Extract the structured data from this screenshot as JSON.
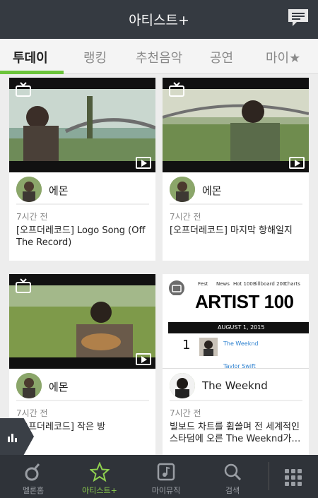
{
  "header": {
    "title": "아티스트+",
    "message_icon": "message-icon"
  },
  "tabs": [
    {
      "label": "투데이",
      "active": true
    },
    {
      "label": "랭킹",
      "active": false
    },
    {
      "label": "추천음악",
      "active": false
    },
    {
      "label": "공연",
      "active": false
    },
    {
      "label": "마이★",
      "active": false
    }
  ],
  "cards": [
    {
      "artist": "에몬",
      "time": "7시간 전",
      "caption": "[오프더레코드] Logo Song (Off The Record)"
    },
    {
      "artist": "에몬",
      "time": "7시간 전",
      "caption": "[오프더레코드] 마지막 항해일지"
    },
    {
      "artist": "에몬",
      "time": "7시간 전",
      "caption": "[오프더레코드] 작은 방"
    },
    {
      "artist": "The Weeknd",
      "time": "7시간 전",
      "caption": "빌보드 차트를 휩쓸며 전 세계적인 스타덤에 오른 The Weeknd가…"
    }
  ],
  "chart_card": {
    "nav": [
      "Fest",
      "News",
      "Hot 100",
      "Billboard 200",
      "Charts"
    ],
    "headline": "ARTIST 100",
    "week": "AUGUST 1, 2015",
    "rank": "1",
    "song1": "The Weeknd",
    "song2": "Taylor Swift"
  },
  "bottom_nav": [
    {
      "label": "멜론홈",
      "icon": "melon-home-icon",
      "active": false
    },
    {
      "label": "아티스트+",
      "icon": "star-icon",
      "active": true
    },
    {
      "label": "마이뮤직",
      "icon": "my-music-icon",
      "active": false
    },
    {
      "label": "검색",
      "icon": "search-icon",
      "active": false
    }
  ],
  "colors": {
    "accent": "#6bc43a",
    "header_bg": "#353a41",
    "nav_bg": "#2f3339"
  }
}
